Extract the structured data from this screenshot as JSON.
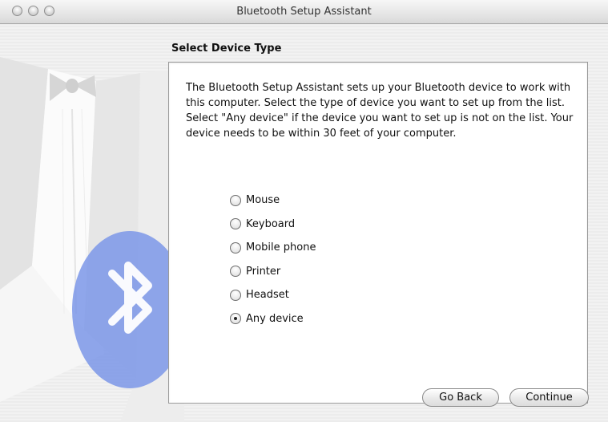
{
  "window": {
    "title": "Bluetooth Setup Assistant"
  },
  "heading": "Select Device Type",
  "description": "The Bluetooth Setup Assistant sets up your Bluetooth device to work with this computer. Select the type of device you want to set up from the list. Select \"Any device\" if the device you want to set up is not on the list. Your device needs to be within 30 feet of your computer.",
  "options": [
    {
      "label": "Mouse",
      "selected": false
    },
    {
      "label": "Keyboard",
      "selected": false
    },
    {
      "label": "Mobile phone",
      "selected": false
    },
    {
      "label": "Printer",
      "selected": false
    },
    {
      "label": "Headset",
      "selected": false
    },
    {
      "label": "Any device",
      "selected": true
    }
  ],
  "buttons": {
    "back": "Go Back",
    "continue": "Continue"
  },
  "colors": {
    "bluetooth": "#6f8fe6",
    "background": "#ececec"
  }
}
